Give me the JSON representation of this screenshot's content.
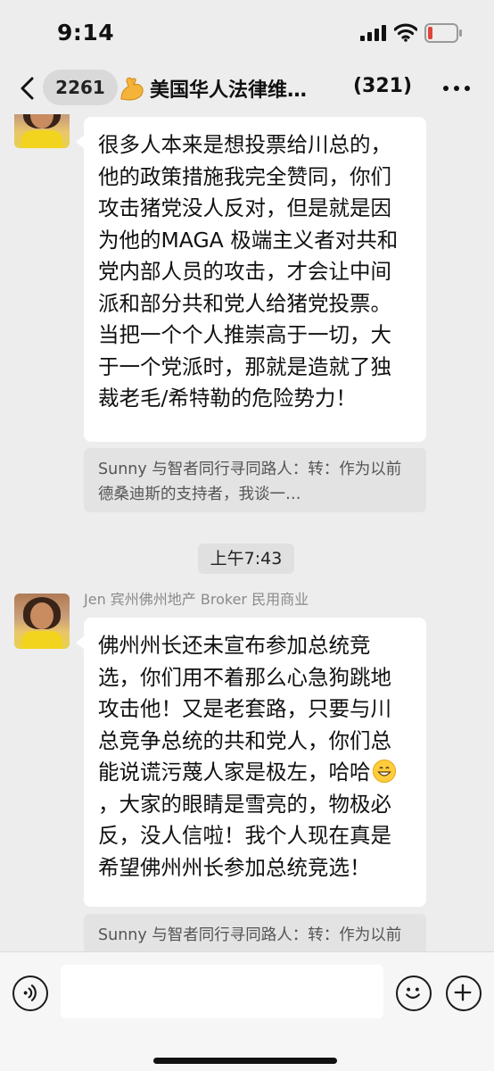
{
  "status_bar": {
    "time": "9:14",
    "icons": [
      "signal-icon",
      "wifi-icon",
      "battery-icon"
    ],
    "battery_color": "#e0443a"
  },
  "nav": {
    "unread_count": "2261",
    "title": "美国华人法律维…",
    "member_count": "(321)",
    "title_icon": "flexed-biceps-icon",
    "back_icon": "chevron-left-icon",
    "more_icon": "ellipsis-icon"
  },
  "messages": [
    {
      "text": "很多人本来是想投票给川总的，他的政策措施我完全赞同，你们攻击猪党没人反对，但是就是因为他的MAGA 极端主义者对共和党内部人员的攻击，才会让中间派和部分共和党人给猪党投票。当把一个个人推崇高于一切，大于一个党派时，那就是造就了独裁老毛/希特勒的危险势力！",
      "quote": "Sunny 与智者同行寻同路人：转：作为以前德桑迪斯的支持者，我谈一…"
    },
    {
      "time": "上午7:43",
      "sender": "Jen 宾州佛州地产 Broker 民用商业",
      "text_before_emoji": "佛州州长还未宣布参加总统竞选，你们用不着那么心急狗跳地攻击他！又是老套路，只要与川总竞争总统的共和党人，你们总能说谎污蔑人家是极左，哈哈",
      "emoji": "grinning-face-emoji",
      "text_after_emoji": "，大家的眼睛是雪亮的，物极必反，没人信啦！我个人现在真是希望佛州州长参加总统竞选！",
      "quote": "Sunny 与智者同行寻同路人：转：作为以前德桑迪斯的支持者，我谈一…"
    }
  ],
  "input_bar": {
    "placeholder": "",
    "icons": [
      "voice-icon",
      "emoji-icon",
      "plus-icon"
    ]
  },
  "colors": {
    "background": "#ededed",
    "bubble": "#ffffff",
    "quote_background": "#e3e3e3",
    "sender_name": "#8a8a8a"
  }
}
